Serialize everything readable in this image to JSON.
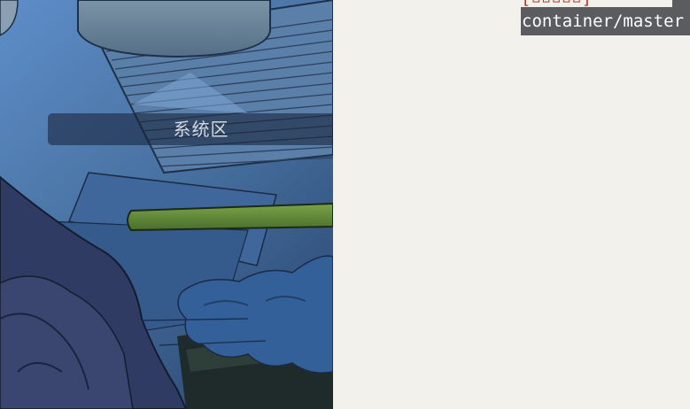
{
  "overlay": {
    "system_area_label": "系统区"
  },
  "terminal": {
    "path_text": "container/master",
    "clipped_top_text": "[▫▫▫▫▫]"
  },
  "colors": {
    "background": "#f2f1ec",
    "path_label_bg": "#5a5c5f",
    "path_label_text": "#ffffff",
    "overlay_bg": "#1a2440",
    "artwork_blue": "#3c5f92",
    "artwork_green": "#5e8a3c",
    "clipped_text_red": "#b33a2e"
  },
  "icons": {
    "artwork": "illustration-image"
  }
}
